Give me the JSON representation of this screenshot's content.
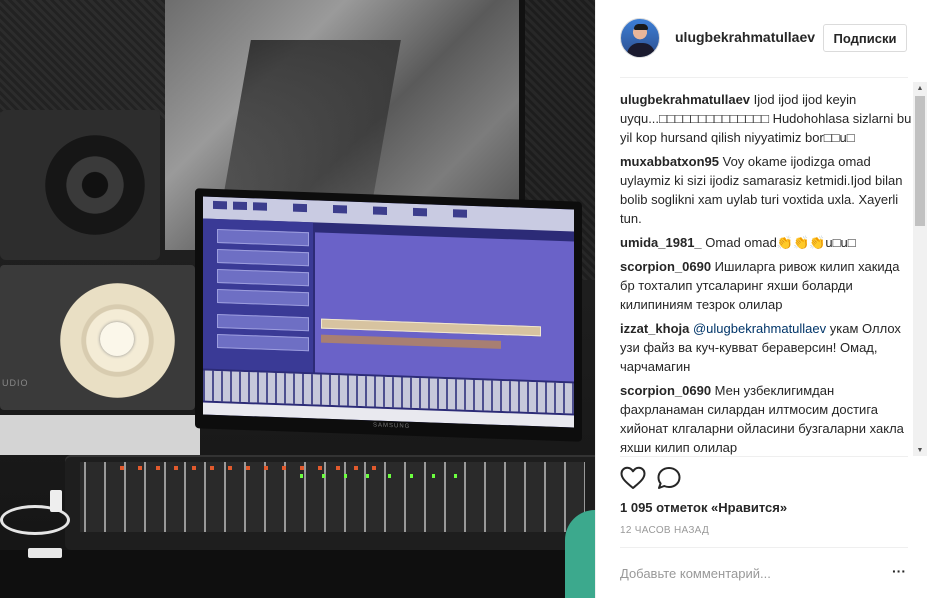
{
  "post": {
    "photo_alt": "recording studio with monitor, speakers and mixing console",
    "screen_brand": "SAMSUNG",
    "speaker_brand": "UDIO"
  },
  "header": {
    "username": "ulugbekrahmatullaev",
    "follow_label": "Подписки"
  },
  "comments": [
    {
      "user": "ulugbekrahmatullaev",
      "text": "Ijod ijod ijod keyin uyqu...□□□□□□□□□□□□□□ Hudohohlasa sizlarni bu yil kop hursand qilish niyyatimiz bor□□u□"
    },
    {
      "user": "muxabbatxon95",
      "text": "Voy okame ijodizga omad uylaymiz ki sizi ijodiz samarasiz ketmidi.Ijod bilan bolib soglikni xam uylab turi voxtida uxla. Xayerli tun."
    },
    {
      "user": "umida_1981_",
      "text": "Omad omad👏👏👏u□u□"
    },
    {
      "user": "scorpion_0690",
      "text": "Ишиларга ривож килип хакида бр тохталип утсаларинг яхши боларди килипиниям тезрок олилар"
    },
    {
      "user": "izzat_khoja",
      "mention": "@ulugbekrahmatullaev",
      "text": "укам Оллох узи файз ва куч-кувват бераверсин! Омад, чарчамагин"
    },
    {
      "user": "scorpion_0690",
      "text": "Мен узбеклигимдан фахрланаман силардан илтмосим достига хийонат клгаларни ойласини бузгаларни хакла яхши килип олилар"
    }
  ],
  "actions": {
    "like_icon": "heart-outline-icon",
    "comment_icon": "speech-bubble-icon"
  },
  "likes_text": "1 095 отметок «Нравится»",
  "timestamp": "12 ЧАСОВ НАЗАД",
  "comment_input": {
    "placeholder": "Добавьте комментарий...",
    "value": ""
  },
  "more_icon": "ellipsis-icon",
  "colors": {
    "text": "#262626",
    "muted": "#999999",
    "border": "#dbdbdb",
    "mention": "#003569"
  }
}
